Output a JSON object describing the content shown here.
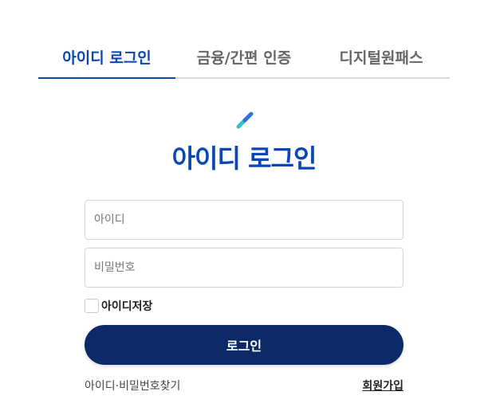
{
  "tabs": [
    {
      "label": "아이디 로그인",
      "active": true
    },
    {
      "label": "금융/간편 인증",
      "active": false
    },
    {
      "label": "디지털원패스",
      "active": false
    }
  ],
  "icon": "pen-icon",
  "title": "아이디 로그인",
  "form": {
    "id_placeholder": "아이디",
    "pw_placeholder": "비밀번호",
    "save_label": "아이디저장",
    "login_label": "로그인"
  },
  "links": {
    "find": "아이디·비밀번호찾기",
    "join": "회원가입"
  },
  "colors": {
    "accent": "#0b46b5",
    "button": "#0b2a67",
    "pen_blue": "#2f6fe0",
    "pen_teal": "#39c1c6"
  }
}
